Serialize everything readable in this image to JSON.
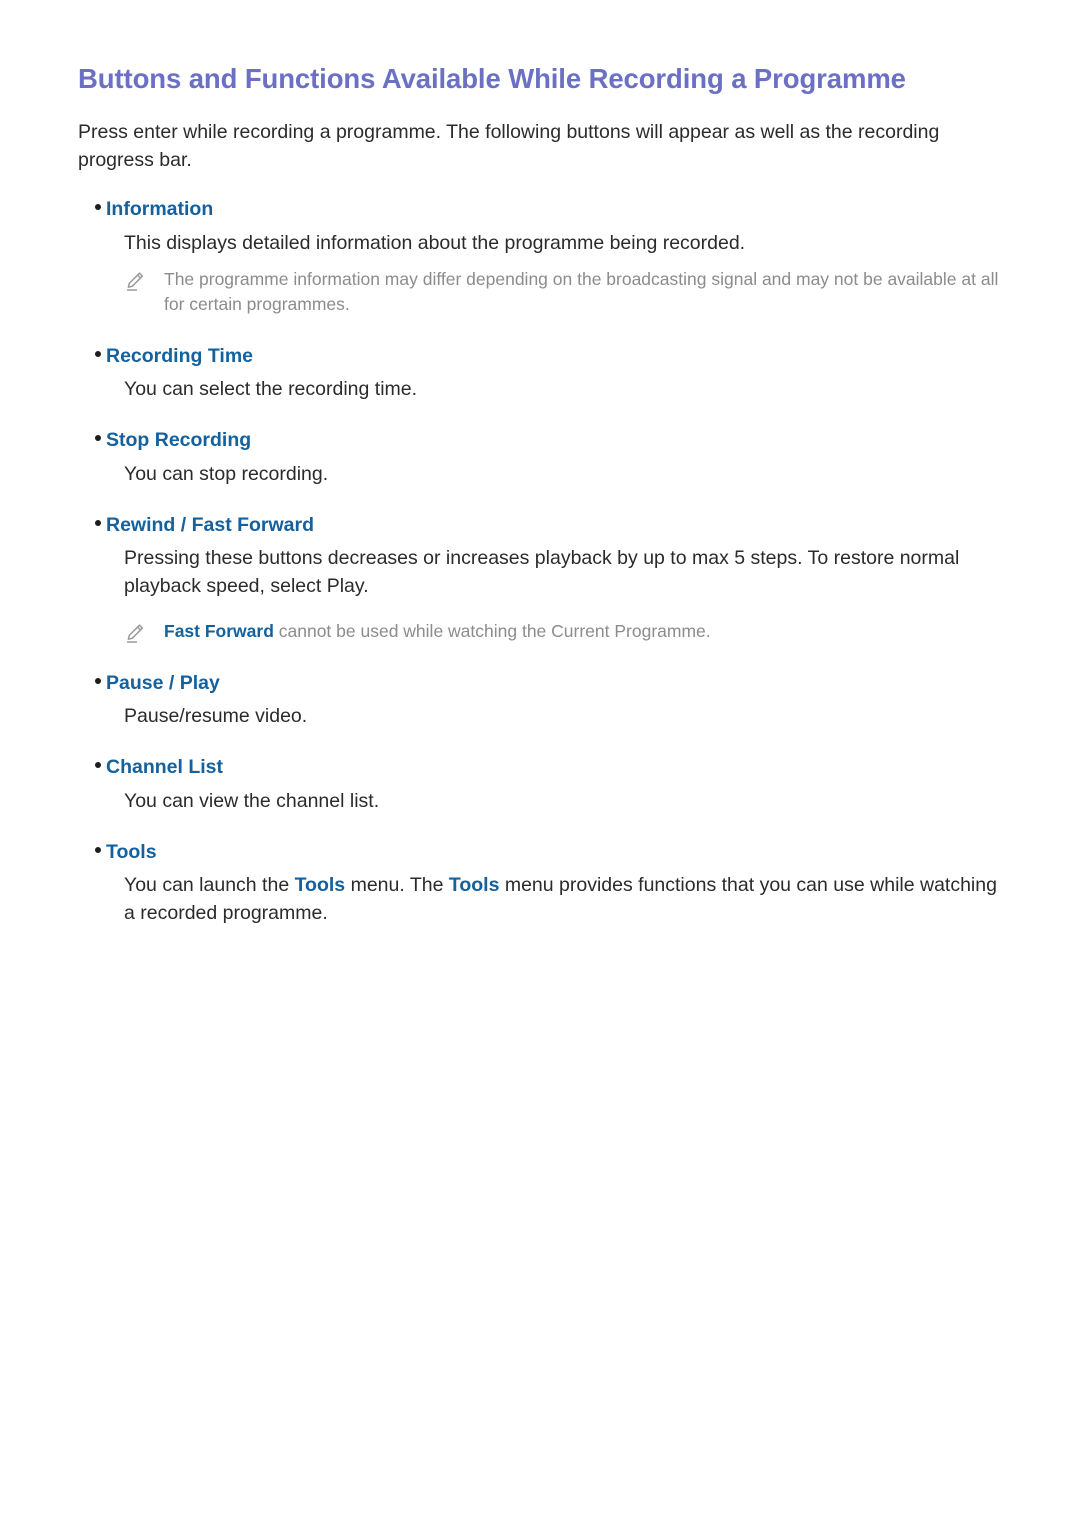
{
  "page": {
    "title": "Buttons and Functions Available While Recording a Programme",
    "intro": "Press enter while recording a programme. The following buttons will appear as well as the recording progress bar."
  },
  "colors": {
    "title": "#6B70C4",
    "heading_blue": "#14619E",
    "body_text": "#2b2b2b",
    "note_text": "#8c8c8c",
    "background": "#ffffff"
  },
  "sections": [
    {
      "heading": "Information",
      "body": "This displays detailed information about the programme being recorded.",
      "note": {
        "icon": "pencil-icon",
        "highlight": "",
        "text": "The programme information may differ depending on the broadcasting signal and may not be available at all for certain programmes."
      }
    },
    {
      "heading": "Recording Time",
      "body": "You can select the recording time.",
      "note": null
    },
    {
      "heading": "Stop Recording",
      "body": "You can stop recording.",
      "note": null
    },
    {
      "heading": "Rewind / Fast Forward",
      "body": "Pressing these buttons decreases or increases playback by up to max 5 steps. To restore normal playback speed, select Play.",
      "note": {
        "icon": "pencil-icon",
        "highlight": "Fast Forward",
        "text": " cannot be used while watching the Current Programme."
      }
    },
    {
      "heading": "Pause / Play",
      "body": "Pause/resume video.",
      "note": null
    },
    {
      "heading": "Channel List",
      "body": "You can view the channel list.",
      "note": null
    },
    {
      "heading": "Tools",
      "body_parts": {
        "before": "You can launch the ",
        "term1": "Tools",
        "middle": " menu. The ",
        "term2": "Tools",
        "after": " menu provides functions that you can use while watching a recorded programme."
      },
      "note": null
    }
  ]
}
